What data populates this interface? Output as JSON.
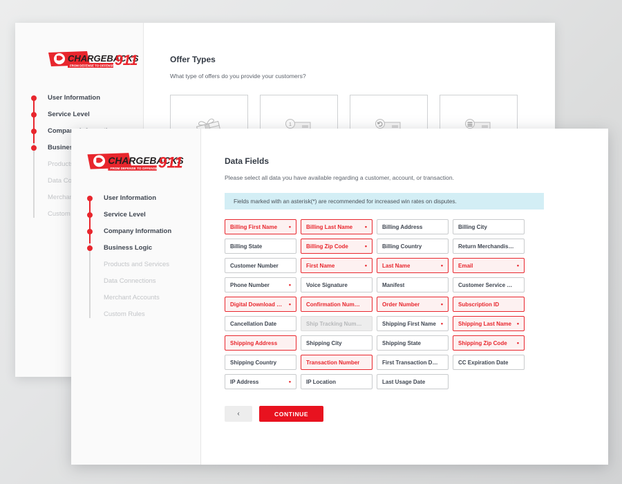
{
  "brand": {
    "logo_name": "CHARGEBACKS",
    "logo_number": "911",
    "logo_tagline": "FROM DEFENSE TO OFFENSE",
    "accent_red": "#e8262d",
    "button_red": "#e8121f",
    "info_blue": "#d3eef5"
  },
  "sidebar": {
    "items": [
      {
        "label": "User Information",
        "active": true
      },
      {
        "label": "Service Level",
        "active": true
      },
      {
        "label": "Company Information",
        "active": true
      },
      {
        "label": "Business Logic",
        "active": true
      },
      {
        "label": "Products and Services",
        "active": false
      },
      {
        "label": "Data Connections",
        "active": false
      },
      {
        "label": "Merchant Accounts",
        "active": false
      },
      {
        "label": "Custom Rules",
        "active": false
      }
    ]
  },
  "back_window": {
    "title": "Offer Types",
    "subtitle": "What type of offers do you provide your customers?",
    "offer_cards": [
      {
        "icon": "gift-box-icon"
      },
      {
        "icon": "product-box-one-icon"
      },
      {
        "icon": "product-box-recurring-icon"
      },
      {
        "icon": "product-box-list-icon"
      }
    ]
  },
  "front_window": {
    "title": "Data Fields",
    "subtitle": "Please select all data you have available regarding a customer, account, or transaction.",
    "info_banner": "Fields marked with an asterisk(*) are recommended for increased win rates on disputes.",
    "rows": [
      [
        {
          "label": "Billing First Name",
          "state": "selected",
          "star": true
        },
        {
          "label": "Billing Last Name",
          "state": "selected",
          "star": true
        },
        {
          "label": "Billing Address",
          "state": "default",
          "star": false
        },
        {
          "label": "Billing City",
          "state": "default",
          "star": false
        }
      ],
      [
        {
          "label": "Billing State",
          "state": "default",
          "star": false
        },
        {
          "label": "Billing Zip Code",
          "state": "selected",
          "star": true
        },
        {
          "label": "Billing Country",
          "state": "default",
          "star": false
        },
        {
          "label": "Return Merchandis…",
          "state": "default",
          "star": false
        }
      ],
      [
        {
          "label": "Customer Number",
          "state": "default",
          "star": false
        },
        {
          "label": "First Name",
          "state": "selected",
          "star": true
        },
        {
          "label": "Last Name",
          "state": "selected",
          "star": true
        },
        {
          "label": "Email",
          "state": "selected",
          "star": true
        }
      ],
      [
        {
          "label": "Phone Number",
          "state": "default",
          "star": true
        },
        {
          "label": "Voice Signature",
          "state": "default",
          "star": false
        },
        {
          "label": "Manifest",
          "state": "default",
          "star": false
        },
        {
          "label": "Customer Service N…",
          "state": "default",
          "star": false
        }
      ],
      [
        {
          "label": "Digital Download N…",
          "state": "selected",
          "star": true
        },
        {
          "label": "Confirmation Number",
          "state": "selected",
          "star": false
        },
        {
          "label": "Order Number",
          "state": "selected",
          "star": true
        },
        {
          "label": "Subscription ID",
          "state": "selected",
          "star": false
        }
      ],
      [
        {
          "label": "Cancellation Date",
          "state": "default",
          "star": false
        },
        {
          "label": "Ship Tracking Num…",
          "state": "disabled",
          "star": false
        },
        {
          "label": "Shipping First Name",
          "state": "default",
          "star": true
        },
        {
          "label": "Shipping Last Name",
          "state": "selected",
          "star": true
        }
      ],
      [
        {
          "label": "Shipping Address",
          "state": "selected",
          "star": false
        },
        {
          "label": "Shipping City",
          "state": "default",
          "star": false
        },
        {
          "label": "Shipping State",
          "state": "default",
          "star": false
        },
        {
          "label": "Shipping Zip Code",
          "state": "selected",
          "star": true
        }
      ],
      [
        {
          "label": "Shipping Country",
          "state": "default",
          "star": false
        },
        {
          "label": "Transaction Number",
          "state": "selected",
          "star": false
        },
        {
          "label": "First Transaction Date",
          "state": "default",
          "star": false
        },
        {
          "label": "CC Expiration Date",
          "state": "default",
          "star": false
        }
      ],
      [
        {
          "label": "IP Address",
          "state": "default",
          "star": true
        },
        {
          "label": "IP Location",
          "state": "default",
          "star": false
        },
        {
          "label": "Last Usage Date",
          "state": "default",
          "star": false
        }
      ]
    ],
    "footer": {
      "back_label": "‹",
      "continue_label": "CONTINUE"
    }
  }
}
